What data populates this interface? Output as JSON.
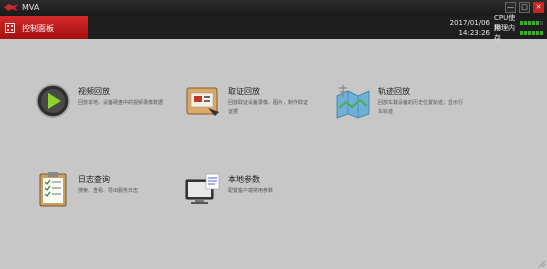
{
  "window": {
    "title": "MVA",
    "minimize_glyph": "—",
    "maximize_glyph": "□",
    "close_glyph": "✕"
  },
  "header": {
    "active_tab": "控制面板",
    "date": "2017/01/06",
    "time": "14:23:26",
    "cpu_label": "CPU使用",
    "mem_label": "物理内存"
  },
  "tiles": [
    {
      "title": "视频回放",
      "desc": "回放本地、设备硬盘中的视频录像数据",
      "icon": "video-playback-icon"
    },
    {
      "title": "取证回放",
      "desc": "回放取证设备录像、图片，制作取证证据",
      "icon": "evidence-playback-icon"
    },
    {
      "title": "轨迹回放",
      "desc": "回放车载设备的历史位置轨迹，显示行车轨迹",
      "icon": "track-playback-icon"
    },
    {
      "title": "日志查询",
      "desc": "搜索、查看、导出服务日志",
      "icon": "log-query-icon"
    },
    {
      "title": "本地参数",
      "desc": "配置客户端常用参数",
      "icon": "local-settings-icon"
    }
  ],
  "colors": {
    "background": "#c7c7c7",
    "titlebar": "#1e1e1e",
    "active_tab": "#c01818",
    "meter_green": "#3fae2a"
  }
}
